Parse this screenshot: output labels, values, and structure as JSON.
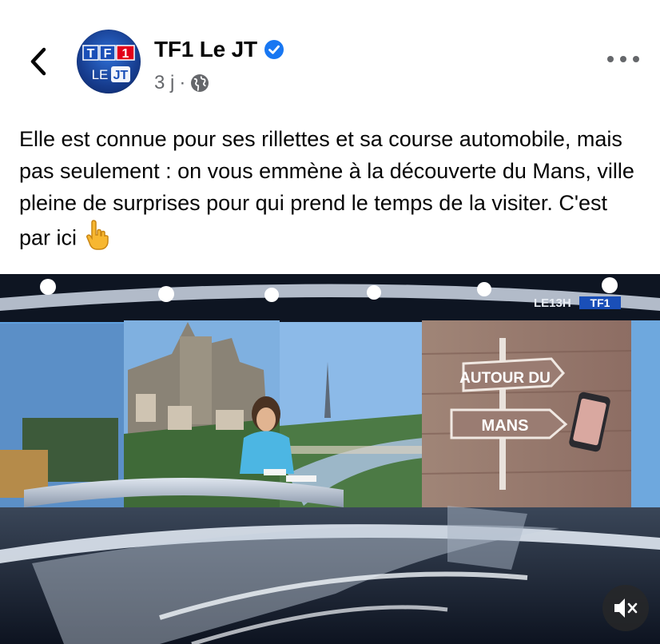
{
  "header": {
    "back_icon": "chevron-left-icon",
    "page_name": "TF1 Le JT",
    "verified_icon": "verified-badge-icon",
    "time": "3 j",
    "separator": "·",
    "audience_icon": "globe-icon",
    "more_icon": "more-horizontal-icon"
  },
  "avatar": {
    "logo_top": "TF1",
    "logo_bottom_left": "LE",
    "logo_bottom_right": "JT"
  },
  "post": {
    "text": "Elle est connue pour ses rillettes et sa course automobile, mais pas seulement : on vous emmène à la découverte du Mans, ville pleine de surprises pour qui prend le temps de la visiter. C'est par ici",
    "emoji": "👇"
  },
  "video": {
    "channel_bug": "LE13H TF1",
    "sign_top": "AUTOUR DU",
    "sign_bottom": "MANS",
    "mute_icon": "speaker-muted-icon"
  },
  "colors": {
    "verified": "#1877f2",
    "secondary_text": "#65676b",
    "tf1_blue": "#1a4fb8",
    "tf1_red": "#e2001a"
  }
}
